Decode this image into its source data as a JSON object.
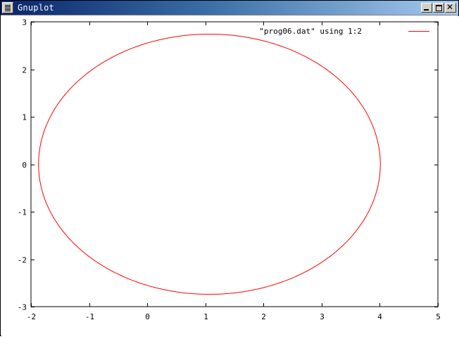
{
  "window": {
    "title": "Gnuplot",
    "controls": {
      "minimize": "minimize-icon",
      "maximize": "maximize-icon",
      "close": "close-icon"
    }
  },
  "chart_data": {
    "type": "line",
    "title": "",
    "xlabel": "",
    "ylabel": "",
    "xlim": [
      -2,
      5
    ],
    "ylim": [
      -3,
      3
    ],
    "xticks": [
      "-2",
      "-1",
      "0",
      "1",
      "2",
      "3",
      "4",
      "5"
    ],
    "yticks": [
      "3",
      "2",
      "1",
      "0",
      "-1",
      "-2",
      "-3"
    ],
    "grid": false,
    "legend_position": "top-right",
    "series": [
      {
        "name": "\"prog06.dat\" using 1:2",
        "color": "#ff0000",
        "shape": "ellipse",
        "center": [
          1.07,
          0
        ],
        "semi_axes": [
          2.94,
          2.74
        ],
        "x": [
          4.01,
          3.68,
          2.54,
          1.07,
          -0.4,
          -1.54,
          -1.87,
          -1.54,
          -0.4,
          1.07,
          2.54,
          3.68,
          4.01
        ],
        "y": [
          0,
          1.37,
          2.37,
          2.74,
          2.37,
          1.37,
          0,
          -1.37,
          -2.37,
          -2.74,
          -2.37,
          -1.37,
          0
        ]
      }
    ]
  }
}
